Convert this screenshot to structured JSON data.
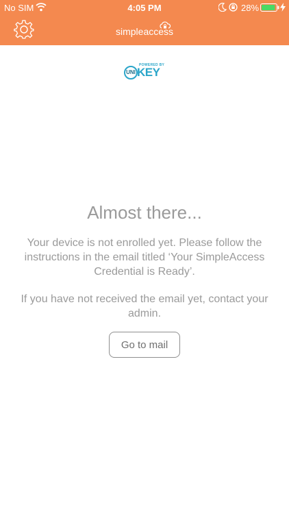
{
  "status_bar": {
    "carrier": "No SIM",
    "time": "4:05 PM",
    "battery_percent": "28%",
    "battery_level": 0.28,
    "icons": [
      "wifi-icon",
      "moon-icon",
      "orientation-lock-icon",
      "battery-icon",
      "charging-bolt-icon"
    ]
  },
  "header": {
    "title": "simpleaccess",
    "icons": [
      "gear-icon",
      "cloud-lock-icon"
    ],
    "background_color": "#f4894f"
  },
  "logo": {
    "tagline": "POWERED BY",
    "brand_part1": "UNI",
    "brand_part2": "KEY"
  },
  "main": {
    "headline": "Almost there...",
    "message_1": "Your device is not enrolled yet. Please follow the instructions in the email titled ‘Your SimpleAccess Credential is Ready’.",
    "message_2": "If you have not received the email yet, contact your admin.",
    "mail_button_label": "Go to mail"
  }
}
